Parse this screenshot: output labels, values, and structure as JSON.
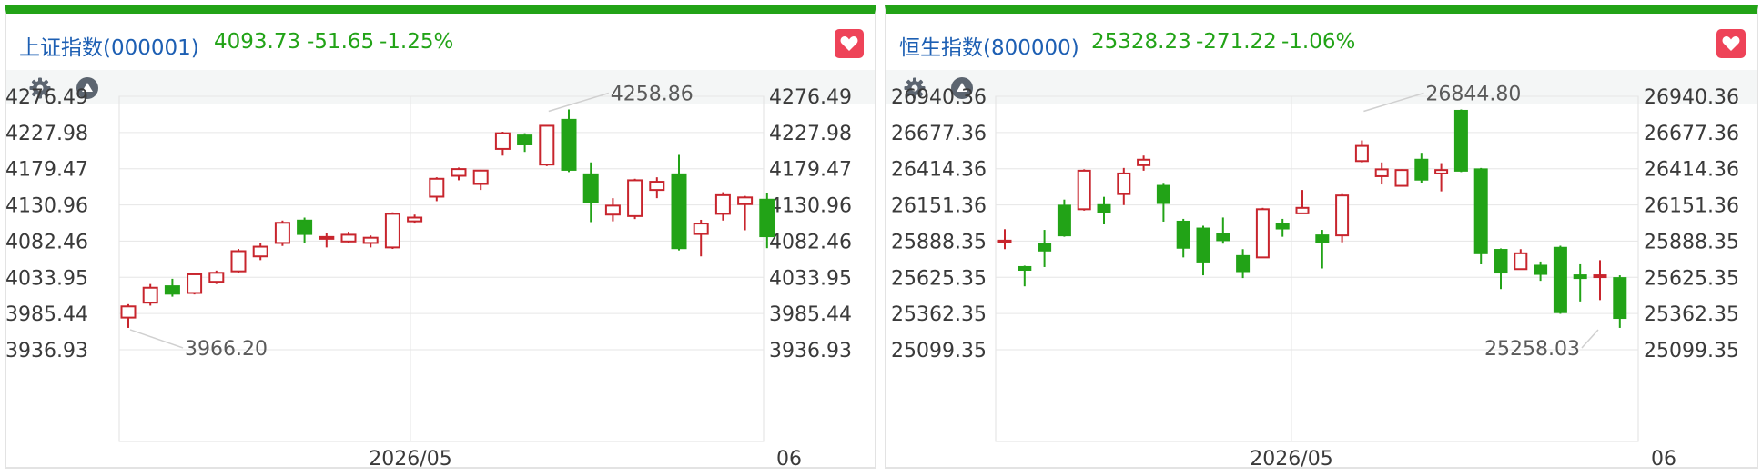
{
  "colors": {
    "up": "#c8252d",
    "down": "#22a317",
    "brand": "#22a317",
    "title": "#1d5fb3",
    "heart": "#ee4358"
  },
  "panels": [
    {
      "name": "上证指数(000001)",
      "price": "4093.73",
      "change": "-51.65",
      "change_pct": "-1.25%",
      "toolbar": {
        "settings_icon": "gear-icon",
        "collapse_icon": "triangle-up-icon"
      },
      "favorite_icon": "heart-icon"
    },
    {
      "name": "恒生指数(800000)",
      "price": "25328.23",
      "change": "-271.22",
      "change_pct": "-1.06%",
      "toolbar": {
        "settings_icon": "gear-icon",
        "collapse_icon": "triangle-up-icon"
      },
      "favorite_icon": "heart-icon"
    }
  ],
  "chart_data": [
    {
      "type": "candlestick",
      "title": "上证指数(000001)",
      "x_tick_labels": [
        "2026/05",
        "06"
      ],
      "y_ticks": [
        "4276.49",
        "4227.98",
        "4179.47",
        "4130.96",
        "4082.46",
        "4033.95",
        "3985.44",
        "3936.93"
      ],
      "y_tick_values": [
        4276.49,
        4227.98,
        4179.47,
        4130.96,
        4082.46,
        4033.95,
        3985.44,
        3936.93
      ],
      "ylim": [
        3936.93,
        4300
      ],
      "grid": true,
      "annotations": [
        {
          "label": "4258.86",
          "value": 4258.86,
          "candle": 19,
          "kind": "max"
        },
        {
          "label": "3966.20",
          "value": 3966.2,
          "candle": 0,
          "kind": "min"
        }
      ],
      "candles": [
        [
          3980,
          3995,
          3966.2,
          3998
        ],
        [
          4000,
          4020,
          3996,
          4025
        ],
        [
          4022,
          4012,
          4008,
          4032
        ],
        [
          4013,
          4038,
          4011,
          4040
        ],
        [
          4028,
          4040,
          4025,
          4043
        ],
        [
          4042,
          4069,
          4040,
          4072
        ],
        [
          4062,
          4075,
          4057,
          4080
        ],
        [
          4080,
          4107,
          4076,
          4110
        ],
        [
          4110,
          4092,
          4080,
          4114
        ],
        [
          4086,
          4088,
          4074,
          4093
        ],
        [
          4082,
          4091,
          4080,
          4095
        ],
        [
          4080,
          4087,
          4074,
          4090
        ],
        [
          4074,
          4119,
          4072,
          4121
        ],
        [
          4109,
          4114,
          4106,
          4118
        ],
        [
          4142,
          4166,
          4136,
          4168
        ],
        [
          4170,
          4179,
          4164,
          4181
        ],
        [
          4159,
          4177,
          4151,
          4178
        ],
        [
          4206,
          4227,
          4197,
          4229
        ],
        [
          4224,
          4212,
          4202,
          4227
        ],
        [
          4185,
          4237,
          4183,
          4238
        ],
        [
          4245,
          4178,
          4175,
          4258.86
        ],
        [
          4172,
          4135,
          4108,
          4188
        ],
        [
          4118,
          4130,
          4109,
          4140
        ],
        [
          4116,
          4164,
          4112,
          4166
        ],
        [
          4151,
          4162,
          4140,
          4168
        ],
        [
          4172,
          4073,
          4070,
          4198
        ],
        [
          4092,
          4106,
          4062,
          4111
        ],
        [
          4119,
          4144,
          4110,
          4148
        ],
        [
          4132,
          4141,
          4097,
          4143
        ],
        [
          4138,
          4089,
          4073,
          4147
        ]
      ]
    },
    {
      "type": "candlestick",
      "title": "恒生指数(800000)",
      "x_tick_labels": [
        "2026/05",
        "06"
      ],
      "y_ticks": [
        "26940.36",
        "26677.36",
        "26414.36",
        "26151.36",
        "25888.35",
        "25625.35",
        "25362.35",
        "25099.35"
      ],
      "y_tick_values": [
        26940.36,
        26677.36,
        26414.36,
        26151.36,
        25888.35,
        25625.35,
        25362.35,
        25099.35
      ],
      "ylim": [
        25099.35,
        27100
      ],
      "grid": true,
      "annotations": [
        {
          "label": "26844.80",
          "value": 26844.8,
          "candle": 18,
          "kind": "max"
        },
        {
          "label": "25258.03",
          "value": 25258.03,
          "candle": 30,
          "kind": "min"
        }
      ],
      "candles": [
        [
          25889,
          25892,
          25830,
          25975
        ],
        [
          25700,
          25680,
          25560,
          25710
        ],
        [
          25870,
          25820,
          25700,
          25970
        ],
        [
          26146,
          25930,
          25920,
          26190
        ],
        [
          26120,
          26400,
          26110,
          26410
        ],
        [
          26150,
          26100,
          26010,
          26210
        ],
        [
          26230,
          26380,
          26150,
          26420
        ],
        [
          26440,
          26480,
          26400,
          26510
        ],
        [
          26290,
          26165,
          26030,
          26305
        ],
        [
          26030,
          25840,
          25770,
          26050
        ],
        [
          25980,
          25740,
          25640,
          26000
        ],
        [
          25940,
          25895,
          25870,
          26060
        ],
        [
          25780,
          25670,
          25620,
          25830
        ],
        [
          25770,
          26120,
          25770,
          26130
        ],
        [
          26010,
          25980,
          25920,
          26050
        ],
        [
          26090,
          26130,
          26090,
          26260
        ],
        [
          25930,
          25880,
          25690,
          25970
        ],
        [
          25930,
          26220,
          25880,
          26230
        ],
        [
          26470,
          26580,
          26460,
          26620
        ],
        [
          26360,
          26410,
          26300,
          26460
        ],
        [
          26290,
          26405,
          26290,
          26410
        ],
        [
          26480,
          26335,
          26310,
          26530
        ],
        [
          26380,
          26405,
          26250,
          26455
        ],
        [
          26835,
          26400,
          26390,
          26844.8
        ],
        [
          26410,
          25800,
          25720,
          26420
        ],
        [
          25825,
          25660,
          25540,
          25835
        ],
        [
          25685,
          25800,
          25690,
          25830
        ],
        [
          25710,
          25650,
          25600,
          25740
        ],
        [
          25840,
          25372,
          25360,
          25855
        ],
        [
          25640,
          25620,
          25450,
          25720
        ],
        [
          25630,
          25640,
          25460,
          25750
        ],
        [
          25620,
          25330,
          25258.03,
          25640
        ]
      ]
    }
  ]
}
